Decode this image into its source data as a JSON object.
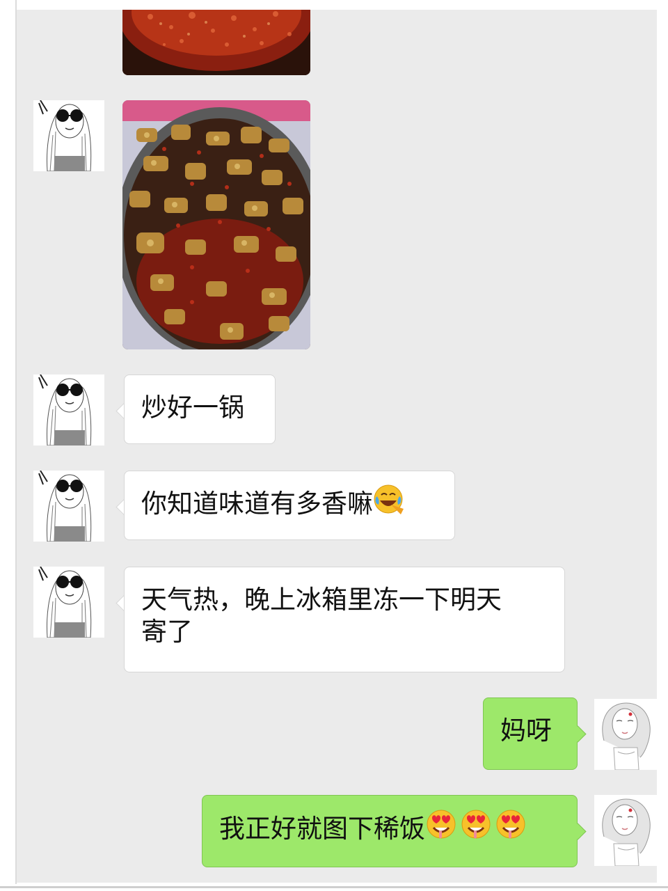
{
  "messages": [
    {
      "id": "m1",
      "side": "left",
      "type": "image",
      "description_icon": "food-photo-partial"
    },
    {
      "id": "m2",
      "side": "left",
      "type": "image",
      "description_icon": "food-photo"
    },
    {
      "id": "m3",
      "side": "left",
      "type": "text",
      "text": "炒好一锅",
      "emoji": []
    },
    {
      "id": "m4",
      "side": "left",
      "type": "text",
      "text": "你知道味道有多香嘛",
      "emoji": [
        "face-with-tears-of-joy"
      ]
    },
    {
      "id": "m5",
      "side": "left",
      "type": "text",
      "text": "天气热，晚上冰箱里冻一下明天\n寄了",
      "emoji": []
    },
    {
      "id": "m6",
      "side": "right",
      "type": "text",
      "text": "妈呀",
      "emoji": []
    },
    {
      "id": "m7",
      "side": "right",
      "type": "text",
      "text": "我正好就图下稀饭",
      "emoji": [
        "drooling-heart-eyes-face",
        "drooling-heart-eyes-face",
        "drooling-heart-eyes-face"
      ]
    }
  ],
  "colors": {
    "chat_background": "#ebebeb",
    "incoming_bubble": "#ffffff",
    "outgoing_bubble": "#9de86a"
  },
  "avatars": {
    "contact": "girl-with-sunglasses-avatar",
    "self": "sketched-girl-avatar"
  }
}
